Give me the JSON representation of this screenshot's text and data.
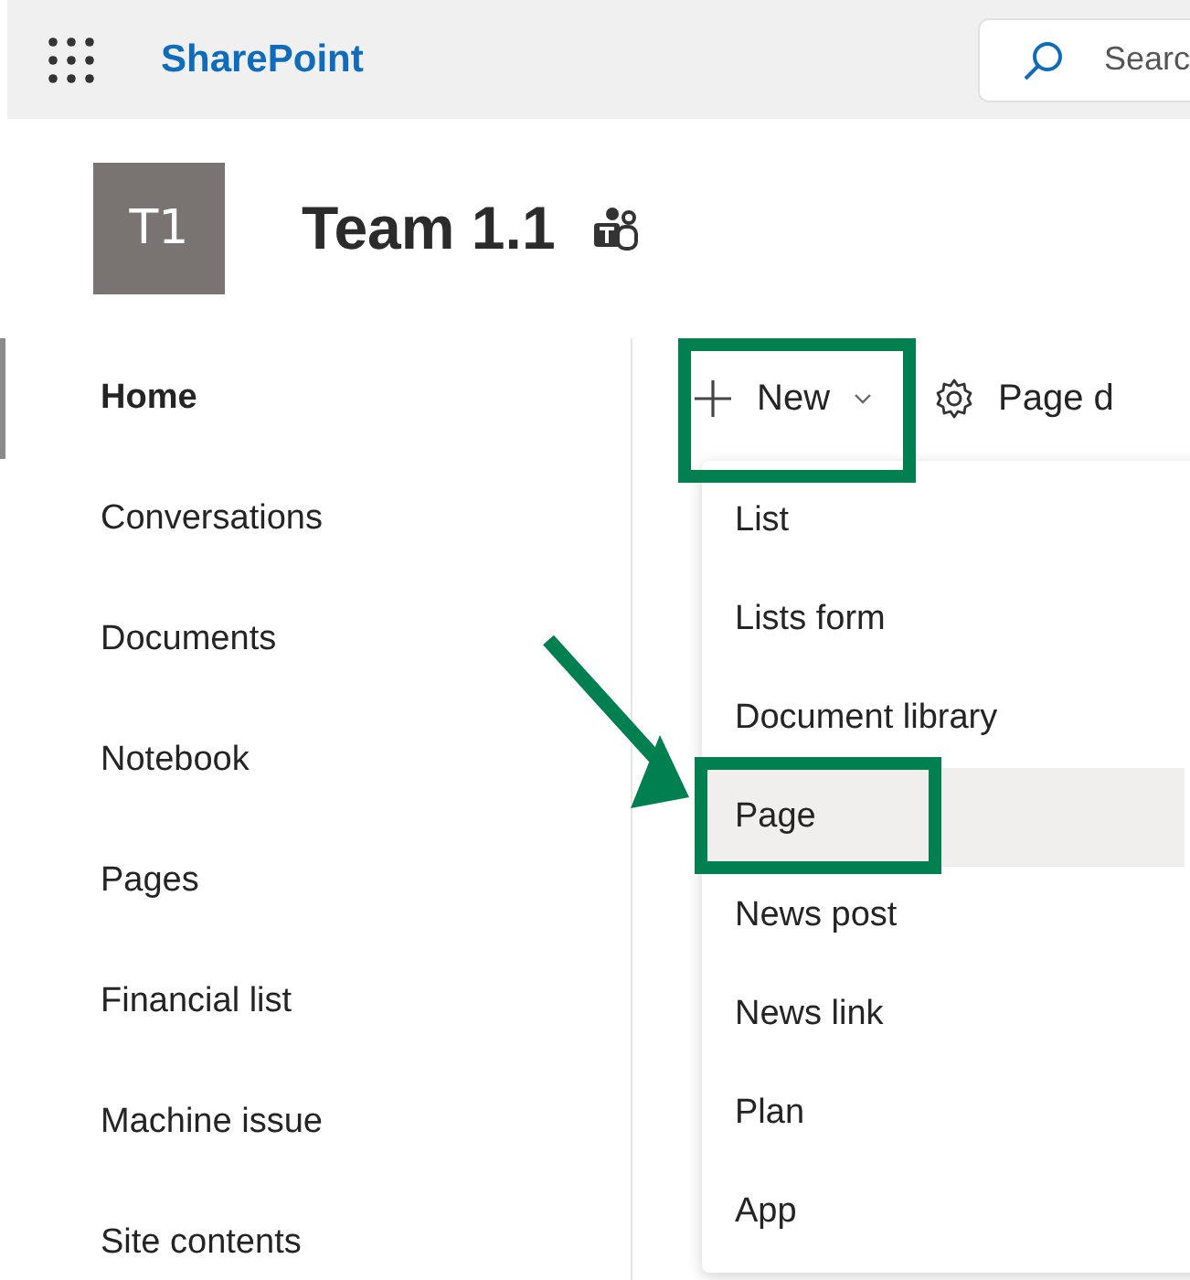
{
  "header": {
    "app_name": "SharePoint",
    "search_placeholder": "Searc"
  },
  "site": {
    "logo_text": "T1",
    "title": "Team 1.1"
  },
  "nav": [
    {
      "label": "Home",
      "selected": true
    },
    {
      "label": "Conversations",
      "selected": false
    },
    {
      "label": "Documents",
      "selected": false
    },
    {
      "label": "Notebook",
      "selected": false
    },
    {
      "label": "Pages",
      "selected": false
    },
    {
      "label": "Financial list",
      "selected": false
    },
    {
      "label": "Machine issue",
      "selected": false
    },
    {
      "label": "Site contents",
      "selected": false
    }
  ],
  "command_bar": {
    "new_label": "New",
    "new_boxed": true,
    "page_details_label": "Page d"
  },
  "new_menu": [
    {
      "label": "List",
      "selected": false,
      "boxed": false
    },
    {
      "label": "Lists form",
      "selected": false,
      "boxed": false
    },
    {
      "label": "Document library",
      "selected": false,
      "boxed": false
    },
    {
      "label": "Page",
      "selected": true,
      "boxed": true
    },
    {
      "label": "News post",
      "selected": false,
      "boxed": false
    },
    {
      "label": "News link",
      "selected": false,
      "boxed": false
    },
    {
      "label": "Plan",
      "selected": false,
      "boxed": false
    },
    {
      "label": "App",
      "selected": false,
      "boxed": false
    }
  ]
}
